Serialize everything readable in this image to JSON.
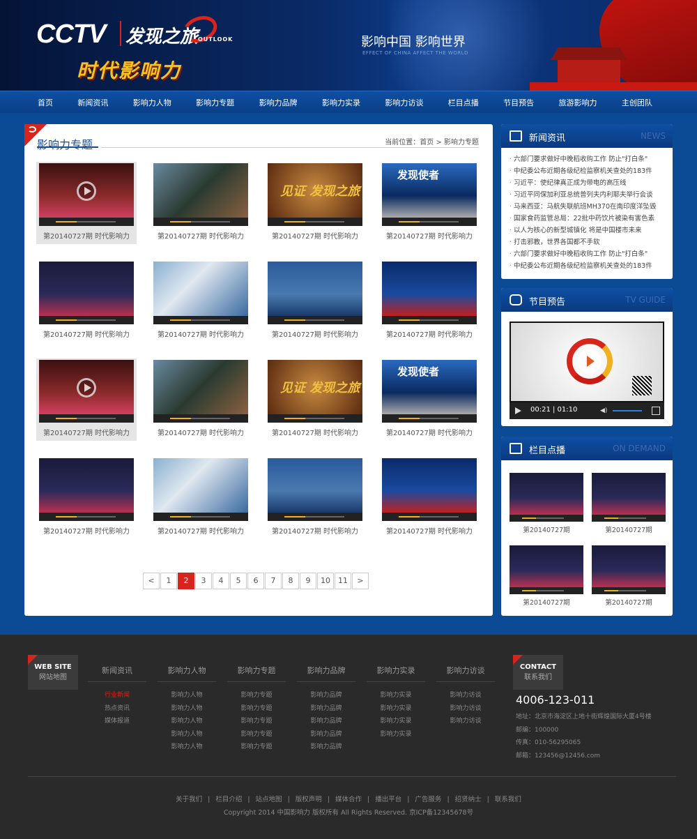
{
  "header": {
    "logo_main": "CCTV",
    "logo_show": "发现之旅",
    "logo_sub": "OUTLOOK",
    "tagline": "时代影响力",
    "slogan": "影响中国 影响世界",
    "slogan_en": "EFFECT OF CHINA AFFECT THE WORLD"
  },
  "nav": {
    "items": [
      "首页",
      "新闻资讯",
      "影响力人物",
      "影响力专题",
      "影响力品牌",
      "影响力实录",
      "影响力访谈",
      "栏目点播",
      "节目预告",
      "旅游影响力",
      "主创团队"
    ]
  },
  "main": {
    "title": "影响力专题",
    "breadcrumb": "当前位置：首页 > 影响力专题",
    "videos": [
      {
        "caption": "第20140727期 时代影响力"
      },
      {
        "caption": "第20140727期 时代影响力"
      },
      {
        "caption": "第20140727期 时代影响力",
        "overlay": "见证 发现之旅"
      },
      {
        "caption": "第20140727期 时代影响力",
        "overlay": "发现使者"
      },
      {
        "caption": "第20140727期 时代影响力"
      },
      {
        "caption": "第20140727期 时代影响力"
      },
      {
        "caption": "第20140727期 时代影响力"
      },
      {
        "caption": "第20140727期 时代影响力"
      },
      {
        "caption": "第20140727期 时代影响力"
      },
      {
        "caption": "第20140727期 时代影响力"
      },
      {
        "caption": "第20140727期 时代影响力",
        "overlay": "见证 发现之旅"
      },
      {
        "caption": "第20140727期 时代影响力",
        "overlay": "发现使者"
      },
      {
        "caption": "第20140727期 时代影响力"
      },
      {
        "caption": "第20140727期 时代影响力"
      },
      {
        "caption": "第20140727期 时代影响力"
      },
      {
        "caption": "第20140727期 时代影响力"
      }
    ],
    "pagination": {
      "prev": "<",
      "pages": [
        "1",
        "2",
        "3",
        "4",
        "5",
        "6",
        "7",
        "8",
        "9",
        "10",
        "11"
      ],
      "current": "2",
      "next": ">"
    }
  },
  "sidebar": {
    "news": {
      "title": "新闻资讯",
      "title_en": "NEWS",
      "items": [
        "六部门要求做好中晚稻收购工作 防止\"打白条\"",
        "中纪委公布近期各级纪检监察机关查处的183件",
        "习近平：使纪律真正成为带电的高压线",
        "习近平同保加利亚总统普列夫内利耶夫举行会谈",
        "马来西亚：马航失联航班MH370在南印度洋坠毁",
        "国家食药监管总局：22批中药饮片被染有害色素",
        "以人为核心的新型城镇化 将是中国楼市未来",
        "打击邪教，世界各国都不手软",
        "六部门要求做好中晚稻收购工作 防止\"打白条\"",
        "中纪委公布近期各级纪检监察机关查处的183件"
      ]
    },
    "schedule": {
      "title": "节目预告",
      "title_en": "TV GUIDE",
      "player_time": "00:21 | 01:10"
    },
    "on_demand": {
      "title": "栏目点播",
      "title_en": "ON DEMAND",
      "items": [
        {
          "caption": "第20140727期"
        },
        {
          "caption": "第20140727期"
        },
        {
          "caption": "第20140727期"
        },
        {
          "caption": "第20140727期"
        }
      ]
    }
  },
  "footer": {
    "site_map": {
      "en": "WEB SITE",
      "cn": "网站地图"
    },
    "columns": [
      {
        "title": "新闻资讯",
        "links": [
          "行业新闻",
          "热点资讯",
          "媒体报道"
        ]
      },
      {
        "title": "影响力人物",
        "links": [
          "影响力人物",
          "影响力人物",
          "影响力人物",
          "影响力人物",
          "影响力人物"
        ]
      },
      {
        "title": "影响力专题",
        "links": [
          "影响力专题",
          "影响力专题",
          "影响力专题",
          "影响力专题",
          "影响力专题"
        ]
      },
      {
        "title": "影响力品牌",
        "links": [
          "影响力品牌",
          "影响力品牌",
          "影响力品牌",
          "影响力品牌",
          "影响力品牌"
        ]
      },
      {
        "title": "影响力实录",
        "links": [
          "影响力实录",
          "影响力实录",
          "影响力实录",
          "影响力实录"
        ]
      },
      {
        "title": "影响力访谈",
        "links": [
          "影响力访谈",
          "影响力访谈",
          "影响力访谈"
        ]
      }
    ],
    "contact": {
      "en": "CONTACT",
      "cn": "联系我们",
      "phone": "4006-123-011",
      "address": "地址：北京市海淀区上地十街辉煌国际大厦4号楼",
      "postcode": "邮编：100000",
      "fax": "传真：010-56295065",
      "email": "邮箱：123456@12456.com"
    },
    "links": [
      "关于我们",
      "栏目介绍",
      "站点地图",
      "版权声明",
      "媒体合作",
      "播出平台",
      "广告服务",
      "招贤纳士",
      "联系我们"
    ],
    "copyright": "Copyright 2014 中国影响力 版权所有 All Rights Reserved.   京ICP备12345678号"
  },
  "colors": {
    "accent_red": "#d9241b",
    "nav_blue": "#0e4fa3",
    "background_blue": "#0b4a95",
    "footer_dark": "#2a2a2a"
  }
}
